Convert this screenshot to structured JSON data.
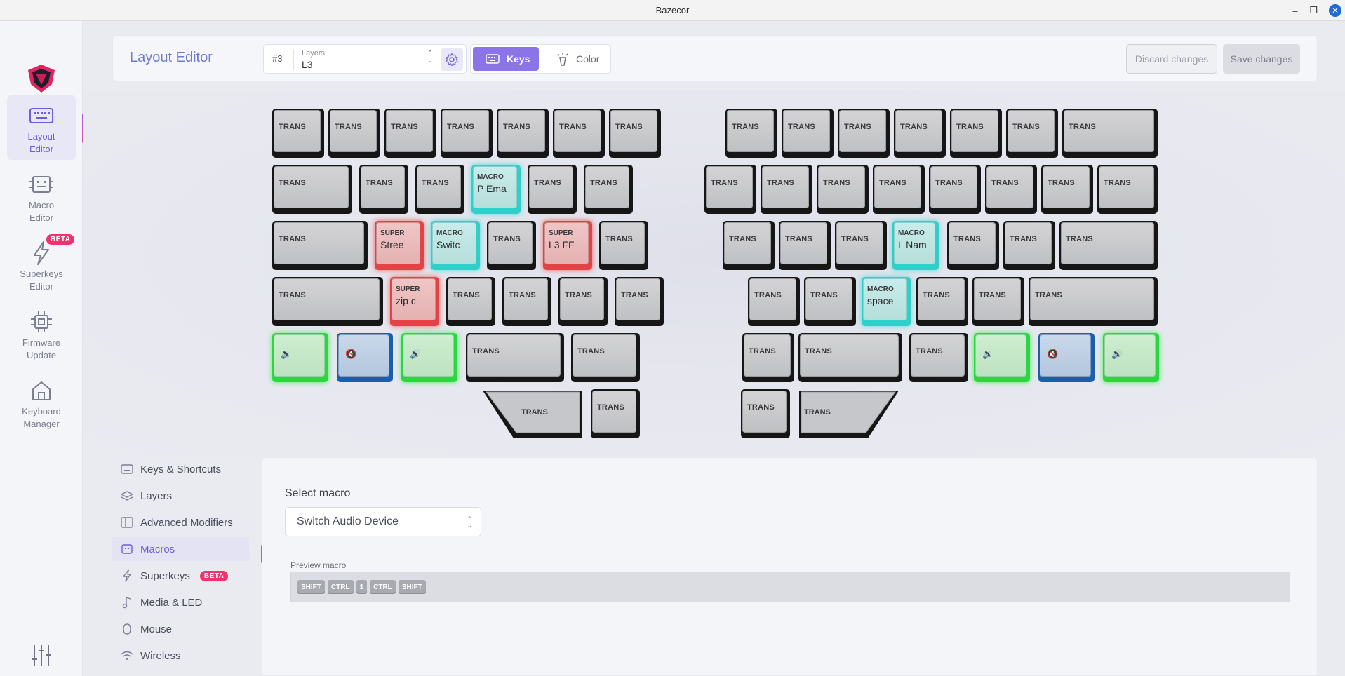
{
  "window": {
    "title": "Bazecor",
    "minimize": "–",
    "maximize": "❐",
    "close": "✕"
  },
  "nav": {
    "items": [
      {
        "label": "Layout\nEditor",
        "l1": "Layout",
        "l2": "Editor",
        "icon": "keyboard-icon"
      },
      {
        "l1": "Macro",
        "l2": "Editor",
        "icon": "macro-icon"
      },
      {
        "l1": "Superkeys",
        "l2": "Editor",
        "icon": "bolt-icon",
        "badge": "BETA"
      },
      {
        "l1": "Firmware",
        "l2": "Update",
        "icon": "chip-icon"
      },
      {
        "l1": "Keyboard",
        "l2": "Manager",
        "icon": "home-icon"
      }
    ]
  },
  "toolbar": {
    "title": "Layout Editor",
    "layer_number": "#3",
    "layer_label": "Layers",
    "layer_value": "L3",
    "mode_keys": "Keys",
    "mode_color": "Color",
    "discard": "Discard changes",
    "save": "Save changes"
  },
  "keys": {
    "trans": "TRANS",
    "macro": "MACRO",
    "super": "SUPER",
    "macro_p_ema": "P Ema",
    "macro_switc": "Switc",
    "macro_l_nam": "L Nam",
    "macro_space": "space",
    "super_stree": "Stree",
    "super_l3ff": "L3 FF",
    "super_zipc": "zip c",
    "vol_down": "🔉",
    "mute": "🔇",
    "vol_up": "🔊"
  },
  "subnav": {
    "items": [
      {
        "label": "Keys & Shortcuts",
        "icon": "keyboard-icon"
      },
      {
        "label": "Layers",
        "icon": "layers-icon"
      },
      {
        "label": "Advanced Modifiers",
        "icon": "modifiers-icon"
      },
      {
        "label": "Macros",
        "icon": "macro-icon"
      },
      {
        "label": "Superkeys",
        "icon": "bolt-icon",
        "badge": "BETA"
      },
      {
        "label": "Media & LED",
        "icon": "music-icon"
      },
      {
        "label": "Mouse",
        "icon": "mouse-icon"
      },
      {
        "label": "Wireless",
        "icon": "wifi-icon"
      }
    ]
  },
  "macro_panel": {
    "select_label": "Select macro",
    "selected": "Switch Audio Device",
    "preview_label": "Preview macro",
    "preview_keys": [
      "SHIFT",
      "CTRL",
      "1",
      "CTRL",
      "SHIFT"
    ]
  },
  "colors": {
    "accent": "#8b74e8",
    "macro": "#31cfc9",
    "super": "#e04444",
    "green": "#2bd640",
    "blue": "#1a5fae",
    "beta": "#f0326e"
  }
}
